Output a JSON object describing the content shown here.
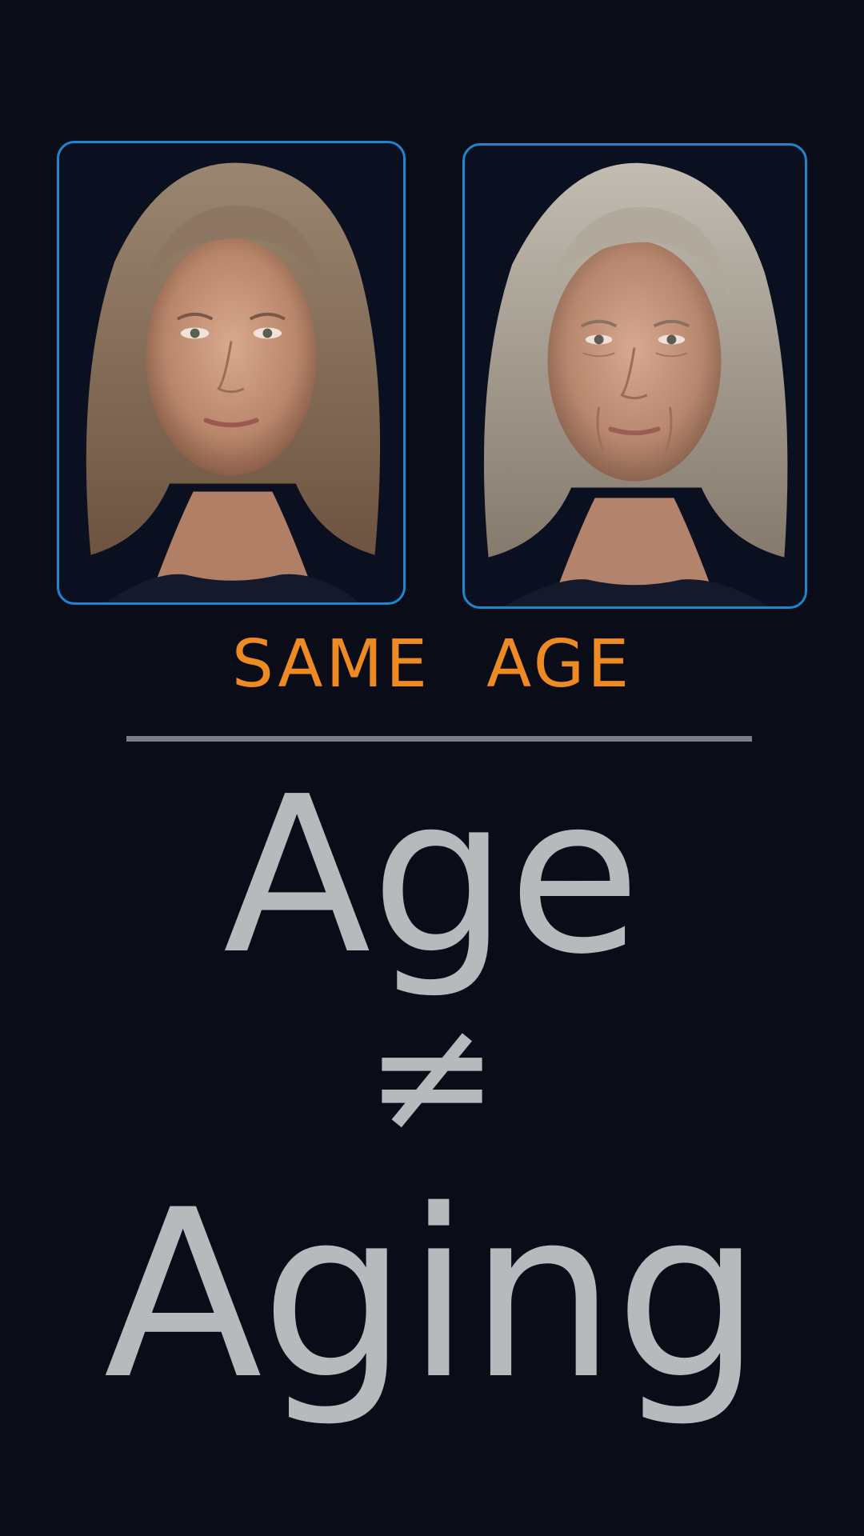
{
  "left_card": {
    "image": "portrait-woman-younger-looking"
  },
  "right_card": {
    "image": "portrait-woman-older-looking"
  },
  "subtitle": "SAME   AGE",
  "headline": {
    "line1": "Age",
    "symbol": "≠",
    "line2": "Aging"
  },
  "colors": {
    "background": "#0a0d18",
    "frame_border": "#1e86cf",
    "subtitle": "#ee8a24",
    "divider": "#7a7d84",
    "headline": "#b8b9bd"
  }
}
